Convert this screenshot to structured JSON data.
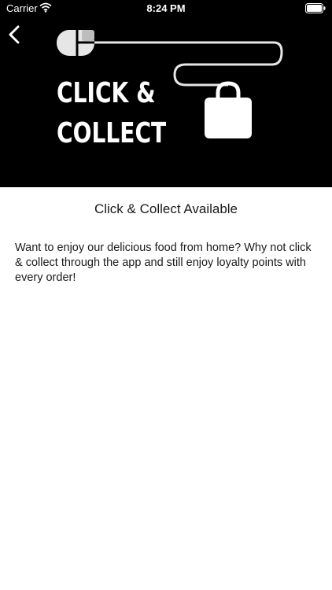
{
  "status_bar": {
    "carrier": "Carrier",
    "time": "8:24 PM",
    "wifi_icon": "wifi-icon",
    "battery_icon": "battery-icon"
  },
  "navigation": {
    "back_icon": "chevron-left-icon"
  },
  "hero": {
    "line1": "CLICK &",
    "line2": "COLLECT",
    "icons": [
      "computer-mouse-icon",
      "shopping-bag-icon"
    ],
    "background_color": "#000000",
    "text_color": "#ffffff"
  },
  "content": {
    "title": "Click & Collect Available",
    "description": "Want to enjoy our delicious food from home? Why not click & collect through the app and still enjoy loyalty points with every order!"
  }
}
